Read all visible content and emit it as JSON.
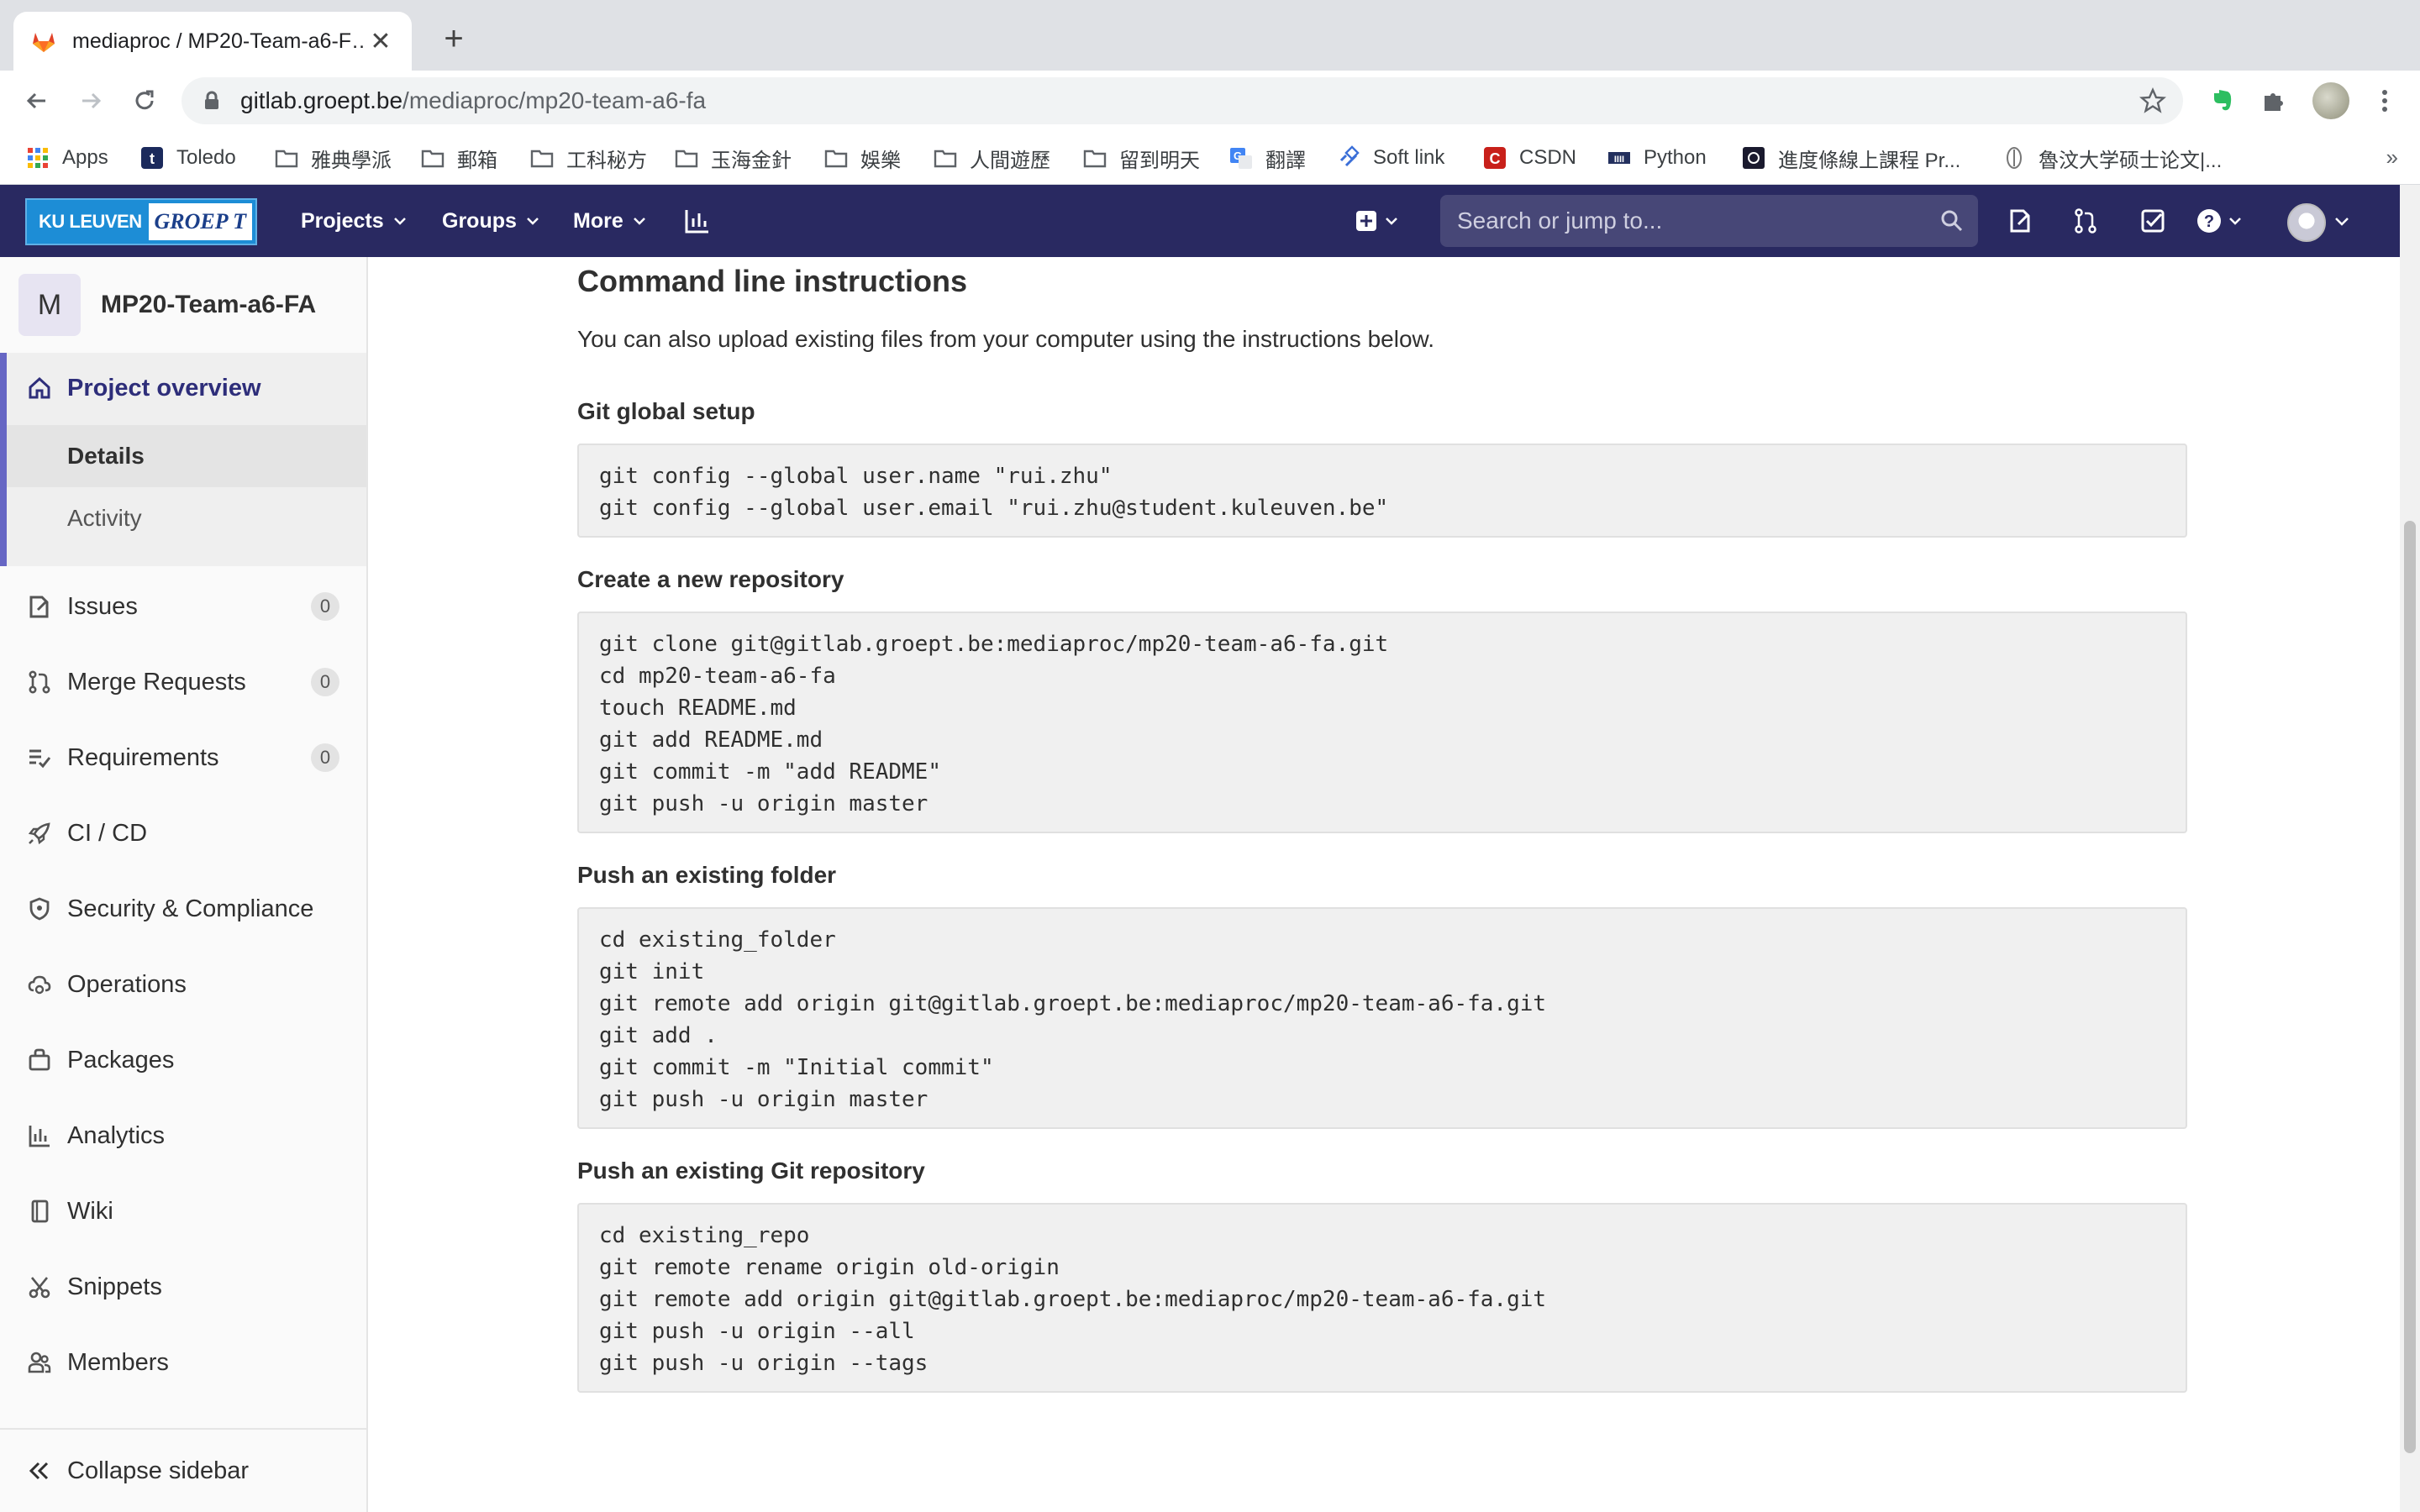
{
  "browser": {
    "tab_title": "mediaproc / MP20-Team-a6-F…",
    "url_host": "gitlab.groept.be",
    "url_path": "/mediaproc/mp20-team-a6-fa",
    "bookmarks": [
      {
        "label": "Apps",
        "icon": "apps-grid-icon"
      },
      {
        "label": "Toledo",
        "icon": "toledo-icon"
      },
      {
        "label": "雅典學派",
        "icon": "folder-icon"
      },
      {
        "label": "郵箱",
        "icon": "folder-icon"
      },
      {
        "label": "工科秘方",
        "icon": "folder-icon"
      },
      {
        "label": "玉海金針",
        "icon": "folder-icon"
      },
      {
        "label": "娛樂",
        "icon": "folder-icon"
      },
      {
        "label": "人間遊歷",
        "icon": "folder-icon"
      },
      {
        "label": "留到明天",
        "icon": "folder-icon"
      },
      {
        "label": "翻譯",
        "icon": "translate-icon"
      },
      {
        "label": "Soft link",
        "icon": "link-icon"
      },
      {
        "label": "CSDN",
        "icon": "csdn-icon"
      },
      {
        "label": "Python",
        "icon": "python-icon"
      },
      {
        "label": "進度條線上課程 Pr...",
        "icon": "progress-icon"
      },
      {
        "label": "魯汶大学硕士论文|...",
        "icon": "thesis-icon"
      }
    ],
    "bookmarks_overflow": "»"
  },
  "gitlab_nav": {
    "brand_left": "KU LEUVEN",
    "brand_right": "GROEP T",
    "menu": [
      "Projects",
      "Groups",
      "More"
    ],
    "search_placeholder": "Search or jump to..."
  },
  "sidebar": {
    "project_initial": "M",
    "project_name": "MP20-Team-a6-FA",
    "overview_label": "Project overview",
    "sub_items": [
      "Details",
      "Activity"
    ],
    "items": [
      {
        "label": "Issues",
        "count": "0",
        "icon": "issues-icon"
      },
      {
        "label": "Merge Requests",
        "count": "0",
        "icon": "merge-request-icon"
      },
      {
        "label": "Requirements",
        "count": "0",
        "icon": "requirements-icon"
      },
      {
        "label": "CI / CD",
        "count": null,
        "icon": "rocket-icon"
      },
      {
        "label": "Security & Compliance",
        "count": null,
        "icon": "shield-icon"
      },
      {
        "label": "Operations",
        "count": null,
        "icon": "cloud-gear-icon"
      },
      {
        "label": "Packages",
        "count": null,
        "icon": "package-icon"
      },
      {
        "label": "Analytics",
        "count": null,
        "icon": "chart-icon"
      },
      {
        "label": "Wiki",
        "count": null,
        "icon": "book-icon"
      },
      {
        "label": "Snippets",
        "count": null,
        "icon": "scissors-icon"
      },
      {
        "label": "Members",
        "count": null,
        "icon": "users-icon"
      }
    ],
    "collapse_label": "Collapse sidebar"
  },
  "main": {
    "title": "Command line instructions",
    "intro": "You can also upload existing files from your computer using the instructions below.",
    "sections": [
      {
        "heading": "Git global setup",
        "code": "git config --global user.name \"rui.zhu\"\ngit config --global user.email \"rui.zhu@student.kuleuven.be\""
      },
      {
        "heading": "Create a new repository",
        "code": "git clone git@gitlab.groept.be:mediaproc/mp20-team-a6-fa.git\ncd mp20-team-a6-fa\ntouch README.md\ngit add README.md\ngit commit -m \"add README\"\ngit push -u origin master"
      },
      {
        "heading": "Push an existing folder",
        "code": "cd existing_folder\ngit init\ngit remote add origin git@gitlab.groept.be:mediaproc/mp20-team-a6-fa.git\ngit add .\ngit commit -m \"Initial commit\"\ngit push -u origin master"
      },
      {
        "heading": "Push an existing Git repository",
        "code": "cd existing_repo\ngit remote rename origin old-origin\ngit remote add origin git@gitlab.groept.be:mediaproc/mp20-team-a6-fa.git\ngit push -u origin --all\ngit push -u origin --tags"
      }
    ]
  },
  "colors": {
    "navbar": "#292961",
    "sidebar_active_border": "#6666c4",
    "code_bg": "#f0f0f0"
  }
}
